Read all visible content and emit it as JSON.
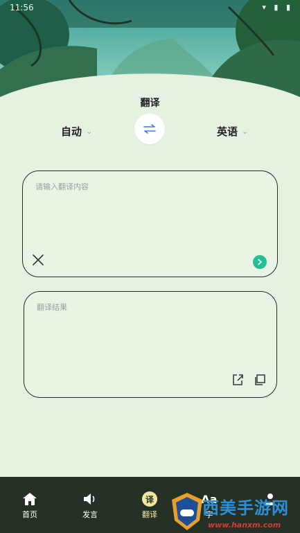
{
  "status_bar": {
    "time": "11:56"
  },
  "page": {
    "title": "翻译"
  },
  "language": {
    "source": "自动",
    "target": "英语"
  },
  "input": {
    "placeholder": "请输入翻译内容"
  },
  "result": {
    "placeholder": "翻译结果"
  },
  "nav": {
    "items": [
      {
        "label": "首页",
        "icon": "home-icon"
      },
      {
        "label": "发言",
        "icon": "speaker-icon"
      },
      {
        "label": "翻译",
        "icon": "translate-icon",
        "badge": "译"
      },
      {
        "label": "字",
        "icon": "font-icon",
        "badge": "Aa"
      },
      {
        "label": "",
        "icon": "profile-icon"
      }
    ]
  },
  "watermark": {
    "brand": "西美手游网",
    "url": "www.hanxm.com"
  },
  "colors": {
    "accent": "#21c097",
    "nav_bg": "#253024",
    "page_bg": "#e6f2e1",
    "active_label": "#f2e7a2"
  }
}
